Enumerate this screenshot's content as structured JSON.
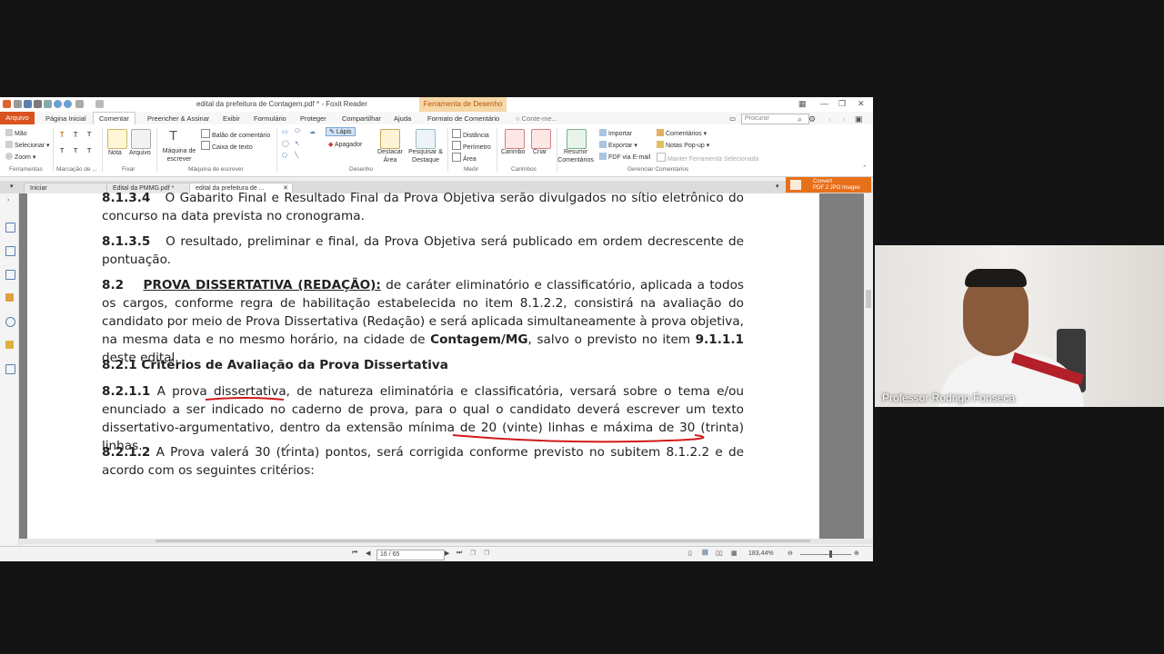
{
  "window": {
    "title": "edital da prefeitura de Contagem.pdf * - Foxit Reader",
    "context_tab": "Ferramenta de Desenho"
  },
  "ribbon_tabs": [
    "Arquivo",
    "Página Inicial",
    "Comentar",
    "Preencher & Assinar",
    "Exibir",
    "Formulário",
    "Proteger",
    "Compartilhar",
    "Ajuda",
    "Formato de Comentário"
  ],
  "tell_me": "Conte-me...",
  "search_placeholder": "Procurar",
  "ribbon": {
    "ferramentas": {
      "items": [
        "Mão",
        "Selecionar",
        "Zoom"
      ],
      "label": "Ferramentas"
    },
    "marcacao_label": "Marcação de ...",
    "fixar": {
      "items": [
        "Nota",
        "Arquivo"
      ],
      "label": "Fixar"
    },
    "maquina": {
      "big": "Máquina de escrever",
      "items": [
        "Balão de comentário",
        "Caixa de texto"
      ],
      "label": "Máquina de escrever"
    },
    "desenho": {
      "items": [
        "Lápis",
        "Apagador"
      ],
      "big1": "Destacar Área",
      "big2": "Pesquisar & Destaque",
      "label": "Desenho"
    },
    "medir": {
      "items": [
        "Distância",
        "Perímetro",
        "Área"
      ],
      "label": "Medir"
    },
    "carimbos": {
      "items": [
        "Carimbo",
        "Criar"
      ],
      "label": "Carimbos"
    },
    "gerenciar": {
      "big": "Resumir Comentários",
      "items": [
        "Importar",
        "Exportar",
        "FDF via E-mail"
      ],
      "items2": [
        "Comentários",
        "Notas Pop-up",
        "Manter Ferramenta Selecionada"
      ],
      "label": "Gerenciar Comentários"
    }
  },
  "doc_tabs": [
    "Iniciar",
    "Edital da PMMG.pdf *",
    "edital da prefeitura de ..."
  ],
  "convert": {
    "line1": "Convert",
    "line2": "PDF 2 JPG Images"
  },
  "document": {
    "p1_num": "8.1.3.4",
    "p1_text": "O Gabarito Final e Resultado Final da Prova Objetiva serão divulgados no sítio eletrônico do concurso na data prevista no cronograma.",
    "p2_num": "8.1.3.5",
    "p2_text": "O resultado, preliminar e final, da Prova Objetiva será publicado em ordem decrescente de pontuação.",
    "p3_num": "8.2",
    "p3_heading": "PROVA DISSERTATIVA (REDAÇÃO):",
    "p3_text_a": "de caráter eliminatório e classificatório, aplicada a todos os cargos, conforme regra de habilitação estabelecida no item 8.1.2.2, consistirá na avaliação do candidato por meio de Prova Dissertativa (Redação) e será aplicada simultaneamente à prova objetiva, na mesma data e no mesmo horário, na cidade de",
    "p3_city": "Contagem/MG",
    "p3_text_b": ", salvo o previsto no item",
    "p3_item": "9.1.1.1",
    "p3_text_c": "deste edital.",
    "p4_heading": "8.2.1 Critérios de Avaliação da Prova Dissertativa",
    "p5_num": "8.2.1.1",
    "p5_text_a": "A prova",
    "p5_word": "dissertativa,",
    "p5_text_b": "de natureza eliminatória e classificatória, versará sobre o tema e/ou enunciado a ser indicado no caderno de prova, para o qual o candidato deverá escrever um texto dissertativo-argumentativo, dentro da extensão mínima de",
    "p5_range": "20 (vinte) linhas e máxima de 30 (trinta)",
    "p5_text_c": "linhas.",
    "p6_num": "8.2.1.2",
    "p6_text": "A Prova valerá 30 (trinta) pontos, será corrigida conforme previsto no subitem 8.1.2.2 e de acordo com os seguintes critérios:"
  },
  "status": {
    "page": "16 / 65",
    "zoom": "183,44%"
  },
  "webcam": {
    "name": "Professor Rodrigo Fonseca"
  },
  "colors": {
    "accent": "#d9531e",
    "annotation": "#d11a1a",
    "convert": "#e8701a"
  }
}
